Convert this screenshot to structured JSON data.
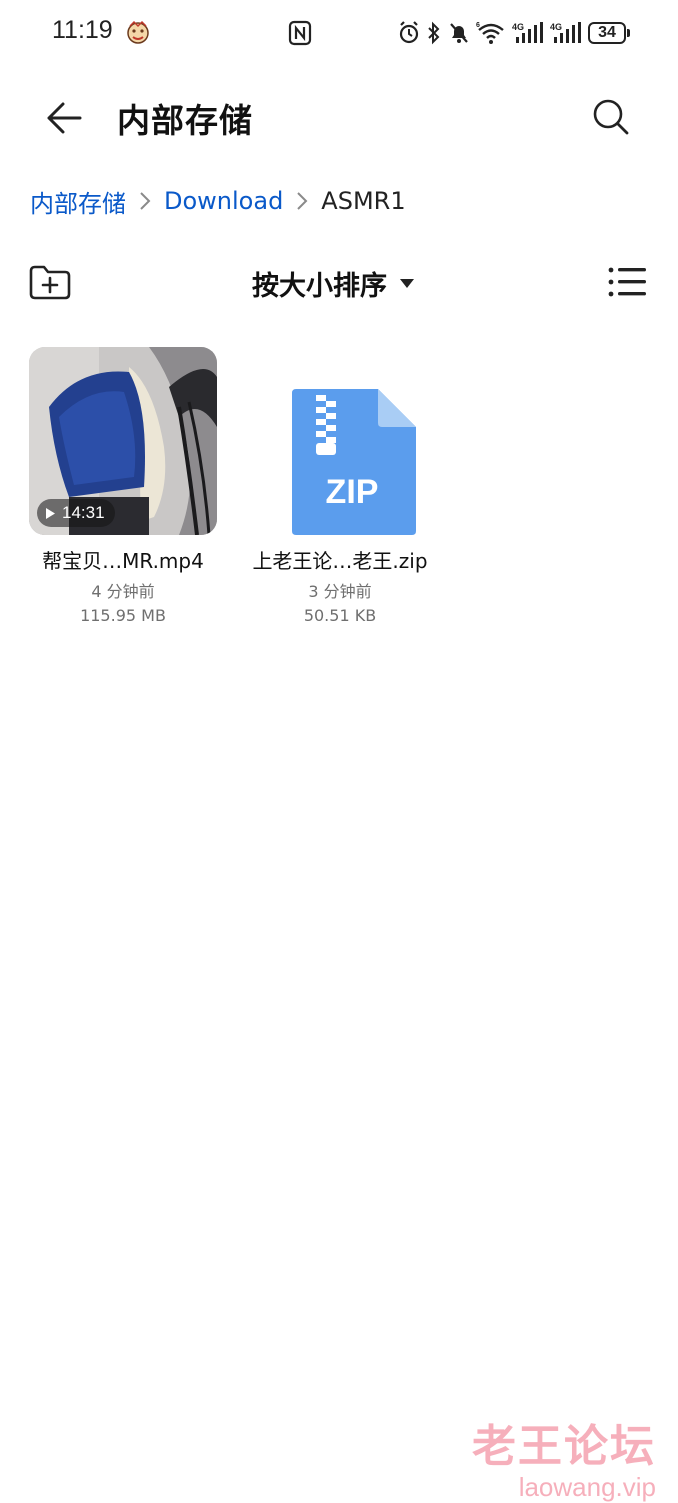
{
  "status_bar": {
    "time": "11:19",
    "battery": "34",
    "icons": [
      "emoji-icon",
      "nfc-icon",
      "alarm-icon",
      "bluetooth-icon",
      "mute-bell-icon",
      "wifi-6-icon",
      "signal-4g-1-icon",
      "signal-4g-2-icon",
      "battery-icon"
    ]
  },
  "header": {
    "title": "内部存储",
    "back_icon": "arrow-left-icon",
    "search_icon": "search-icon"
  },
  "breadcrumb": {
    "items": [
      "内部存储",
      "Download",
      "ASMR1"
    ]
  },
  "toolbar": {
    "sort_label": "按大小排序",
    "new_folder_icon": "new-folder-icon",
    "view_icon": "list-view-icon"
  },
  "files": [
    {
      "name": "帮宝贝…MR.mp4",
      "time": "4 分钟前",
      "size": "115.95 MB",
      "duration": "14:31",
      "kind": "video"
    },
    {
      "name": "上老王论…老王.zip",
      "time": "3 分钟前",
      "size": "50.51 KB",
      "kind": "zip",
      "icon_label": "ZIP"
    }
  ],
  "watermark": {
    "cn": "老王论坛",
    "en": "laowang.vip"
  },
  "colors": {
    "accent": "#0a59c9",
    "zip_icon": "#5b9ded",
    "watermark": "#f5a2b0"
  }
}
